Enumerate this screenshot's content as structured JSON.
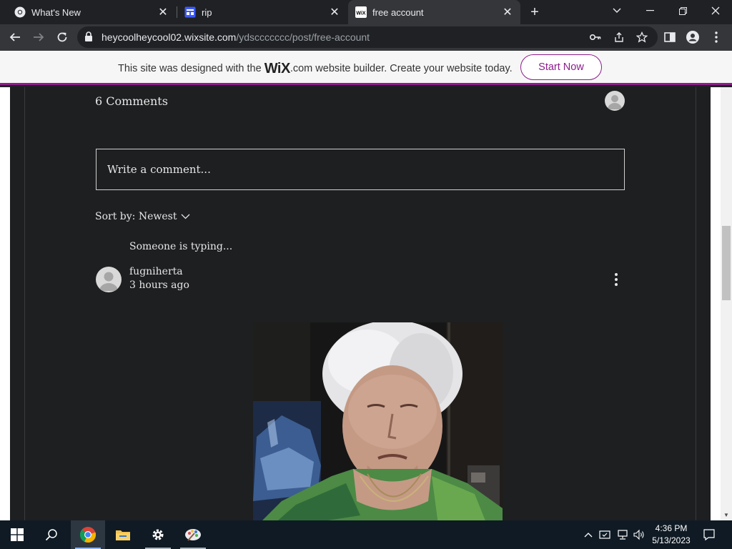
{
  "browser": {
    "tabs": [
      {
        "title": "What's New",
        "icon": "chrome-icon",
        "active": false
      },
      {
        "title": "rip",
        "icon": "wix-site-icon",
        "active": false
      },
      {
        "title": "free account",
        "icon": "wix-icon",
        "active": true
      }
    ],
    "wix_favicon_text": "WiX",
    "url_host": "heycoolheycool02.wixsite.com",
    "url_path": "/ydsccccccc/post/free-account"
  },
  "wix_banner": {
    "prefix": "This site was designed with the ",
    "logo": "WiX",
    "suffix": ".com website builder. Create your website today.",
    "button": "Start Now",
    "accent": "#8c1d8c"
  },
  "comments": {
    "count_label": "6 Comments",
    "write_placeholder": "Write a comment...",
    "sort_label": "Sort by: Newest",
    "typing": "Someone is typing...",
    "items": [
      {
        "author": "fugniherta",
        "time": "3 hours ago"
      }
    ]
  },
  "taskbar": {
    "apps": [
      "windows-start-icon",
      "search-icon",
      "chrome-icon",
      "file-explorer-icon",
      "settings-icon",
      "paint-icon"
    ],
    "time": "4:36 PM",
    "date": "5/13/2023"
  }
}
